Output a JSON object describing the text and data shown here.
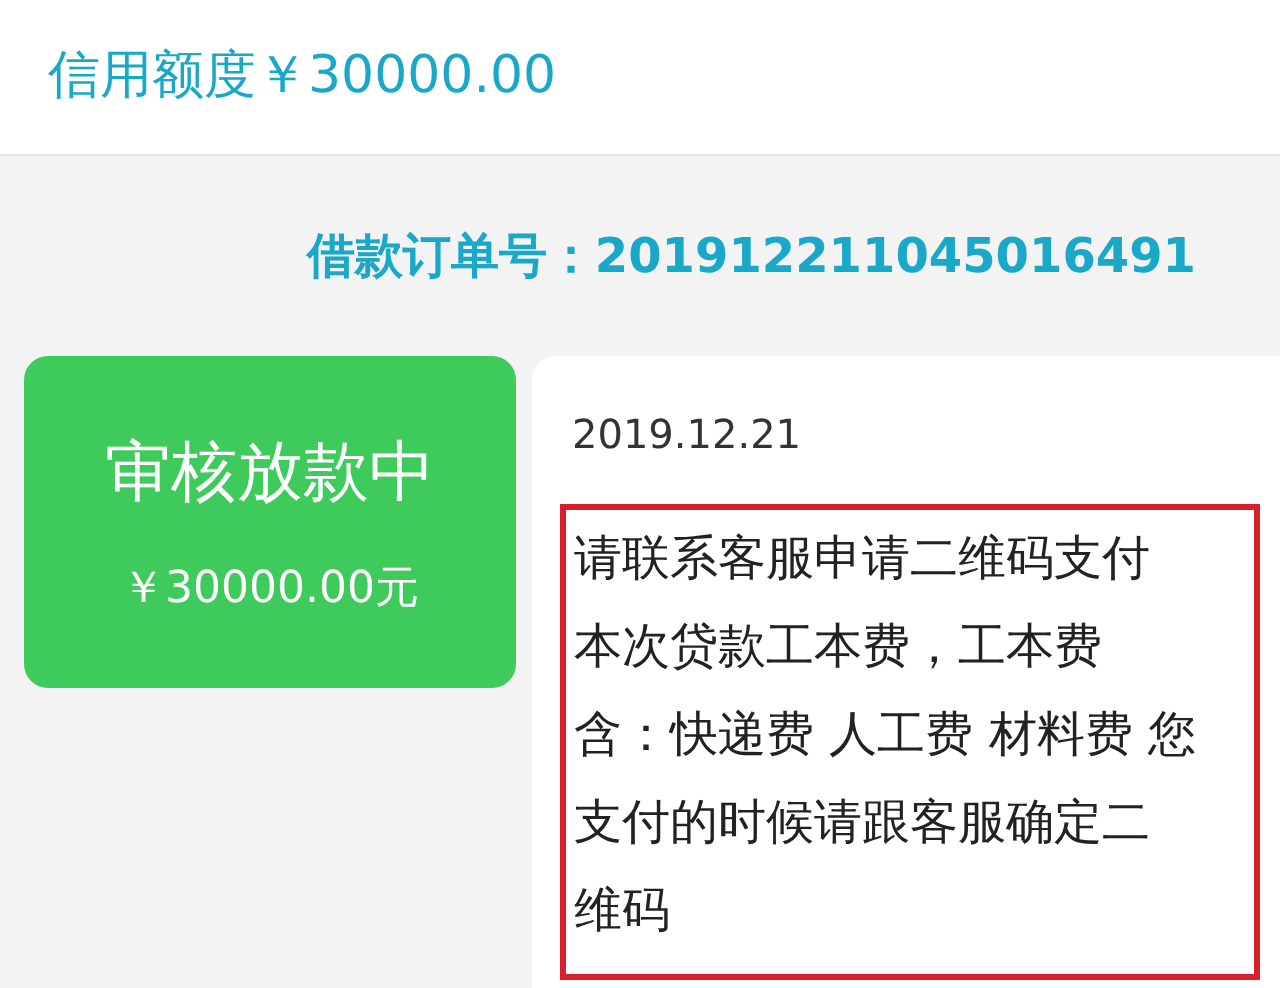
{
  "credit_limit": "信用额度￥30000.00",
  "order_number": "借款订单号：201912211045016491",
  "status_card": {
    "title": "审核放款中",
    "amount": "￥30000.00元"
  },
  "detail": {
    "date": "2019.12.21",
    "message_lines": [
      "请联系客服申请二维码支付",
      "本次贷款工本费，工本费",
      "含：快递费 人工费 材料费 您",
      "支付的时候请跟客服确定二",
      "维码"
    ],
    "highlighted": true
  }
}
